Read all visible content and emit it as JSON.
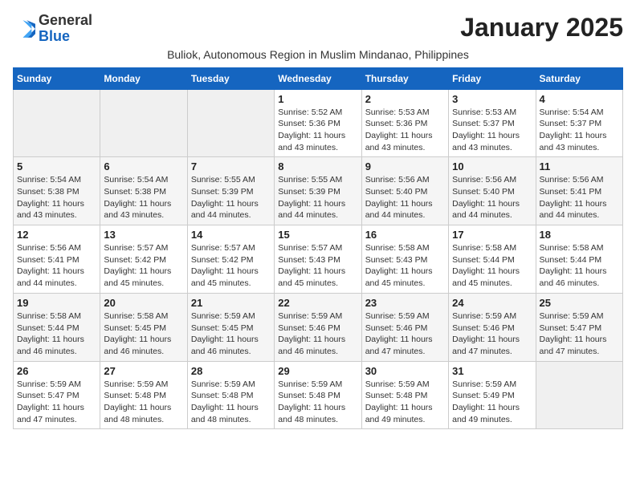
{
  "logo": {
    "general": "General",
    "blue": "Blue"
  },
  "title": "January 2025",
  "subtitle": "Buliok, Autonomous Region in Muslim Mindanao, Philippines",
  "headers": [
    "Sunday",
    "Monday",
    "Tuesday",
    "Wednesday",
    "Thursday",
    "Friday",
    "Saturday"
  ],
  "weeks": [
    [
      {
        "day": "",
        "sunrise": "",
        "sunset": "",
        "daylight": "",
        "empty": true
      },
      {
        "day": "",
        "sunrise": "",
        "sunset": "",
        "daylight": "",
        "empty": true
      },
      {
        "day": "",
        "sunrise": "",
        "sunset": "",
        "daylight": "",
        "empty": true
      },
      {
        "day": "1",
        "sunrise": "Sunrise: 5:52 AM",
        "sunset": "Sunset: 5:36 PM",
        "daylight": "Daylight: 11 hours and 43 minutes.",
        "empty": false
      },
      {
        "day": "2",
        "sunrise": "Sunrise: 5:53 AM",
        "sunset": "Sunset: 5:36 PM",
        "daylight": "Daylight: 11 hours and 43 minutes.",
        "empty": false
      },
      {
        "day": "3",
        "sunrise": "Sunrise: 5:53 AM",
        "sunset": "Sunset: 5:37 PM",
        "daylight": "Daylight: 11 hours and 43 minutes.",
        "empty": false
      },
      {
        "day": "4",
        "sunrise": "Sunrise: 5:54 AM",
        "sunset": "Sunset: 5:37 PM",
        "daylight": "Daylight: 11 hours and 43 minutes.",
        "empty": false
      }
    ],
    [
      {
        "day": "5",
        "sunrise": "Sunrise: 5:54 AM",
        "sunset": "Sunset: 5:38 PM",
        "daylight": "Daylight: 11 hours and 43 minutes.",
        "empty": false
      },
      {
        "day": "6",
        "sunrise": "Sunrise: 5:54 AM",
        "sunset": "Sunset: 5:38 PM",
        "daylight": "Daylight: 11 hours and 43 minutes.",
        "empty": false
      },
      {
        "day": "7",
        "sunrise": "Sunrise: 5:55 AM",
        "sunset": "Sunset: 5:39 PM",
        "daylight": "Daylight: 11 hours and 44 minutes.",
        "empty": false
      },
      {
        "day": "8",
        "sunrise": "Sunrise: 5:55 AM",
        "sunset": "Sunset: 5:39 PM",
        "daylight": "Daylight: 11 hours and 44 minutes.",
        "empty": false
      },
      {
        "day": "9",
        "sunrise": "Sunrise: 5:56 AM",
        "sunset": "Sunset: 5:40 PM",
        "daylight": "Daylight: 11 hours and 44 minutes.",
        "empty": false
      },
      {
        "day": "10",
        "sunrise": "Sunrise: 5:56 AM",
        "sunset": "Sunset: 5:40 PM",
        "daylight": "Daylight: 11 hours and 44 minutes.",
        "empty": false
      },
      {
        "day": "11",
        "sunrise": "Sunrise: 5:56 AM",
        "sunset": "Sunset: 5:41 PM",
        "daylight": "Daylight: 11 hours and 44 minutes.",
        "empty": false
      }
    ],
    [
      {
        "day": "12",
        "sunrise": "Sunrise: 5:56 AM",
        "sunset": "Sunset: 5:41 PM",
        "daylight": "Daylight: 11 hours and 44 minutes.",
        "empty": false
      },
      {
        "day": "13",
        "sunrise": "Sunrise: 5:57 AM",
        "sunset": "Sunset: 5:42 PM",
        "daylight": "Daylight: 11 hours and 45 minutes.",
        "empty": false
      },
      {
        "day": "14",
        "sunrise": "Sunrise: 5:57 AM",
        "sunset": "Sunset: 5:42 PM",
        "daylight": "Daylight: 11 hours and 45 minutes.",
        "empty": false
      },
      {
        "day": "15",
        "sunrise": "Sunrise: 5:57 AM",
        "sunset": "Sunset: 5:43 PM",
        "daylight": "Daylight: 11 hours and 45 minutes.",
        "empty": false
      },
      {
        "day": "16",
        "sunrise": "Sunrise: 5:58 AM",
        "sunset": "Sunset: 5:43 PM",
        "daylight": "Daylight: 11 hours and 45 minutes.",
        "empty": false
      },
      {
        "day": "17",
        "sunrise": "Sunrise: 5:58 AM",
        "sunset": "Sunset: 5:44 PM",
        "daylight": "Daylight: 11 hours and 45 minutes.",
        "empty": false
      },
      {
        "day": "18",
        "sunrise": "Sunrise: 5:58 AM",
        "sunset": "Sunset: 5:44 PM",
        "daylight": "Daylight: 11 hours and 46 minutes.",
        "empty": false
      }
    ],
    [
      {
        "day": "19",
        "sunrise": "Sunrise: 5:58 AM",
        "sunset": "Sunset: 5:44 PM",
        "daylight": "Daylight: 11 hours and 46 minutes.",
        "empty": false
      },
      {
        "day": "20",
        "sunrise": "Sunrise: 5:58 AM",
        "sunset": "Sunset: 5:45 PM",
        "daylight": "Daylight: 11 hours and 46 minutes.",
        "empty": false
      },
      {
        "day": "21",
        "sunrise": "Sunrise: 5:59 AM",
        "sunset": "Sunset: 5:45 PM",
        "daylight": "Daylight: 11 hours and 46 minutes.",
        "empty": false
      },
      {
        "day": "22",
        "sunrise": "Sunrise: 5:59 AM",
        "sunset": "Sunset: 5:46 PM",
        "daylight": "Daylight: 11 hours and 46 minutes.",
        "empty": false
      },
      {
        "day": "23",
        "sunrise": "Sunrise: 5:59 AM",
        "sunset": "Sunset: 5:46 PM",
        "daylight": "Daylight: 11 hours and 47 minutes.",
        "empty": false
      },
      {
        "day": "24",
        "sunrise": "Sunrise: 5:59 AM",
        "sunset": "Sunset: 5:46 PM",
        "daylight": "Daylight: 11 hours and 47 minutes.",
        "empty": false
      },
      {
        "day": "25",
        "sunrise": "Sunrise: 5:59 AM",
        "sunset": "Sunset: 5:47 PM",
        "daylight": "Daylight: 11 hours and 47 minutes.",
        "empty": false
      }
    ],
    [
      {
        "day": "26",
        "sunrise": "Sunrise: 5:59 AM",
        "sunset": "Sunset: 5:47 PM",
        "daylight": "Daylight: 11 hours and 47 minutes.",
        "empty": false
      },
      {
        "day": "27",
        "sunrise": "Sunrise: 5:59 AM",
        "sunset": "Sunset: 5:48 PM",
        "daylight": "Daylight: 11 hours and 48 minutes.",
        "empty": false
      },
      {
        "day": "28",
        "sunrise": "Sunrise: 5:59 AM",
        "sunset": "Sunset: 5:48 PM",
        "daylight": "Daylight: 11 hours and 48 minutes.",
        "empty": false
      },
      {
        "day": "29",
        "sunrise": "Sunrise: 5:59 AM",
        "sunset": "Sunset: 5:48 PM",
        "daylight": "Daylight: 11 hours and 48 minutes.",
        "empty": false
      },
      {
        "day": "30",
        "sunrise": "Sunrise: 5:59 AM",
        "sunset": "Sunset: 5:48 PM",
        "daylight": "Daylight: 11 hours and 49 minutes.",
        "empty": false
      },
      {
        "day": "31",
        "sunrise": "Sunrise: 5:59 AM",
        "sunset": "Sunset: 5:49 PM",
        "daylight": "Daylight: 11 hours and 49 minutes.",
        "empty": false
      },
      {
        "day": "",
        "sunrise": "",
        "sunset": "",
        "daylight": "",
        "empty": true
      }
    ]
  ]
}
